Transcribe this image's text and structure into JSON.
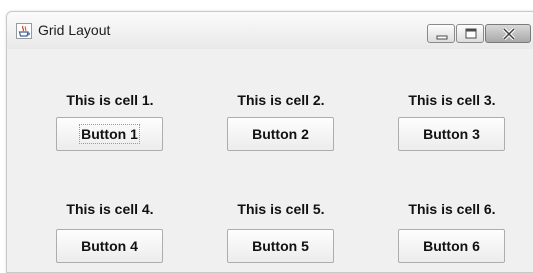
{
  "window": {
    "title": "Grid Layout",
    "icon": "java-cup-icon"
  },
  "controls": {
    "minimize_icon": "minimize-icon",
    "maximize_icon": "maximize-icon",
    "close_icon": "close-icon"
  },
  "grid": {
    "cells": [
      {
        "label": "This is cell 1.",
        "button": "Button 1"
      },
      {
        "label": "This is cell 2.",
        "button": "Button 2"
      },
      {
        "label": "This is cell 3.",
        "button": "Button 3"
      },
      {
        "label": "This is cell 4.",
        "button": "Button 4"
      },
      {
        "label": "This is cell 5.",
        "button": "Button 5"
      },
      {
        "label": "This is cell 6.",
        "button": "Button 6"
      }
    ],
    "focused_button": "Button 1"
  }
}
